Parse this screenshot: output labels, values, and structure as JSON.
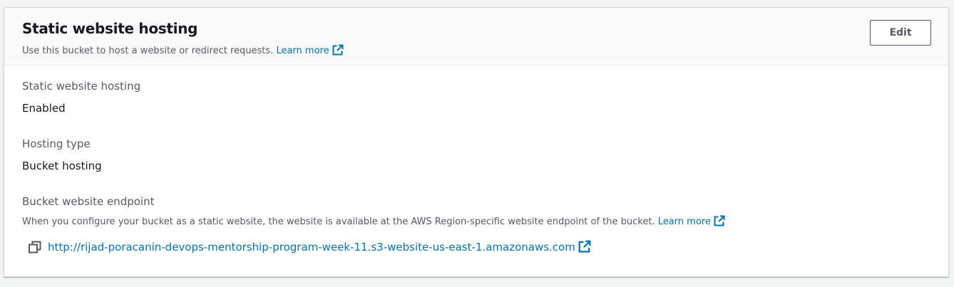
{
  "section": {
    "title": "Static website hosting",
    "description": "Use this bucket to host a website or redirect requests.",
    "learn_more": "Learn more",
    "edit_label": "Edit"
  },
  "fields": {
    "hosting": {
      "label": "Static website hosting",
      "value": "Enabled"
    },
    "type": {
      "label": "Hosting type",
      "value": "Bucket hosting"
    },
    "endpoint": {
      "label": "Bucket website endpoint",
      "description": "When you configure your bucket as a static website, the website is available at the AWS Region-specific website endpoint of the bucket.",
      "learn_more": "Learn more",
      "url": "http://rijad-poracanin-devops-mentorship-program-week-11.s3-website-us-east-1.amazonaws.com"
    }
  },
  "icons": {
    "external": "external-link-icon",
    "copy": "copy-icon"
  },
  "colors": {
    "link": "#0073bb",
    "text": "#16191f",
    "secondary_text": "#545b64",
    "header_bg": "#fafafa",
    "page_bg": "#f2f3f3"
  }
}
